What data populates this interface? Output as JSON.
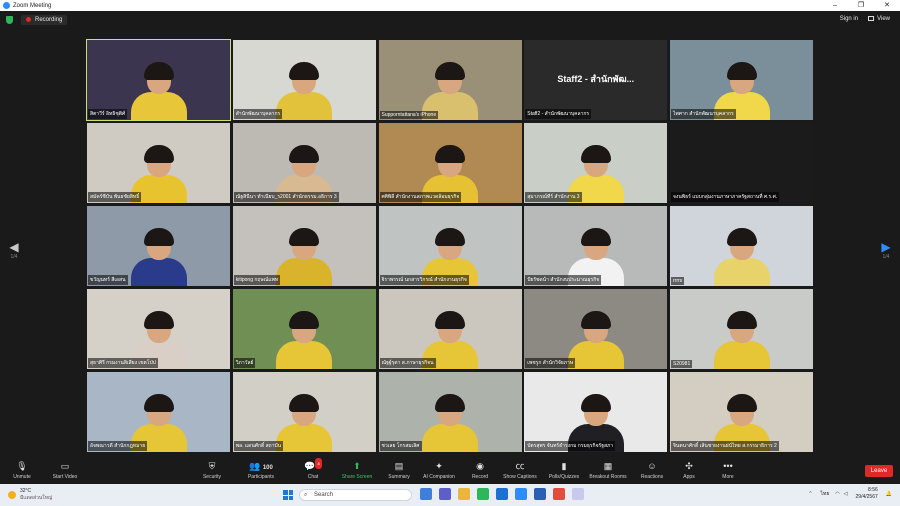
{
  "window": {
    "title": "Zoom Meeting",
    "controls": [
      "–",
      "❐",
      "✕"
    ]
  },
  "topbar": {
    "recording": "Recording",
    "sign_in": "Sign in",
    "view": "View"
  },
  "pager": {
    "left": "1/4",
    "right": "1/4"
  },
  "tiles": [
    {
      "name": "สิตาวีร์ อิทธิชุติศ์",
      "bg": "#3b3550",
      "shirt": "#e8c63a",
      "active": true
    },
    {
      "name": "สำนักพัฒนาบุคลากร",
      "bg": "#d8d8d2",
      "shirt": "#e3c23b"
    },
    {
      "name": "Supporntattana's iPhone",
      "bg": "#9a8f77",
      "shirt": "#d9c06e"
    },
    {
      "name": "Staff2 - สำนักพัฒนาบุคลากร",
      "bg": "#2a2a2a",
      "label": "Staff2 - สำนักพัฒ..."
    },
    {
      "name": "ไพศาก สำนักพัฒนาบุคลากร",
      "bg": "#7b8f9a",
      "shirt": "#f0d84a"
    },
    {
      "name": "สมัคร์ชีบัน พันธชัยสิทธิ์",
      "bg": "#cfcac2",
      "shirt": "#e7c42f"
    },
    {
      "name": "ณัฐสินีนา ทำเนียบ_ร2001 สำนักธรรม.อธิการ 3",
      "bg": "#bdbab3",
      "shirt": "#d8ba92"
    },
    {
      "name": "ศศิพิลี สำนักงานสภาพแวดล้อมธุรกิจ",
      "bg": "#b08a52",
      "shirt": "#e6c133"
    },
    {
      "name": "สุมาภรณ์ทีร์ สำนักงาน 3",
      "bg": "#c9cfc6",
      "shirt": "#f0d84a"
    },
    {
      "name": "จงนพิธร์ แบบกลุ่มงานภาษาภาครัฐสถานที่ ศ.ร.ศ.",
      "bg": "#1b1b1b"
    },
    {
      "name": "ขวัญนทร์ สีเอสน",
      "bg": "#8f9aa8",
      "shirt": "#2a3b8c"
    },
    {
      "name": "kitipong กฤษณ์แพท",
      "bg": "#c4c0bb",
      "shirt": "#d9b32b"
    },
    {
      "name": "จิราพรรณ์ นกสารวิกรณ์ สำนักงานธุรกิจ",
      "bg": "#bfc4c2",
      "shirt": "#e6c537"
    },
    {
      "name": "ปัยรัชดน้า สำนักงบประมาณธุรกิจ",
      "bg": "#b8bab9",
      "shirt": "#f2f2f2"
    },
    {
      "name": "rrrrs",
      "bg": "#cfd5da",
      "shirt": "#e7d36a"
    },
    {
      "name": "สุธาศิรี กรมงานสิเสียง เขตโป่ป",
      "bg": "#d6d1c8",
      "shirt": "#d9cfc6"
    },
    {
      "name": "วิภาวัลย์",
      "bg": "#6f8f55",
      "shirt": "#e6c537"
    },
    {
      "name": "ณัฐฐ์รุดา ส.ภาษาธุรกิจน",
      "bg": "#cbc7be",
      "shirt": "#e6c537"
    },
    {
      "name": "เพชรูก สำนักวิจัยภาษ",
      "bg": "#8d8a84",
      "shirt": "#e6c537"
    },
    {
      "name": "S20981",
      "bg": "#c9cbc8",
      "shirt": "#e6c537"
    },
    {
      "name": "อัจพณาวดี สำนักกฎหมาย",
      "bg": "#a9b6c6",
      "shirt": "#e6c537"
    },
    {
      "name": "พล. แดนศักดิ์ สถาบัน",
      "bg": "#d2cfc7",
      "shirt": "#e6c537"
    },
    {
      "name": "ชวเลย โกรสมเลิศ",
      "bg": "#adb3aa",
      "shirt": "#e6c537"
    },
    {
      "name": "บัตรสุพร จันทร์ธำรงกม กรมธุรกิจรัฐสภา",
      "bg": "#e9e9e9",
      "shirt": "#1f1f24"
    },
    {
      "name": "จินตนาศักดิ์ เส้นชายงานฝน์ไทย ส.กรรมาธิการ 2",
      "bg": "#d4cdc1",
      "shirt": "#e6c537"
    }
  ],
  "toolbar": {
    "unmute": "Unmute",
    "start_video": "Start Video",
    "security": "Security",
    "participants": "Participants",
    "participants_count": "100",
    "chat": "Chat",
    "chat_badge": "8",
    "share_screen": "Share Screen",
    "summary": "Summary",
    "ai_companion": "AI Companion",
    "record": "Record",
    "show_captions": "Show Captions",
    "polls": "Polls/Quizzes",
    "breakout": "Breakout Rooms",
    "reactions": "Reactions",
    "apps": "Apps",
    "more": "More",
    "leave": "Leave"
  },
  "taskbar": {
    "temperature": "32°C",
    "weather_desc": "มีแดดส่วนใหญ่",
    "search_placeholder": "Search",
    "language": "ไทย",
    "time": "8:56",
    "date": "29/4/2567"
  },
  "colors": {
    "accent": "#2d8cff",
    "leave": "#e02828",
    "active_border": "#c9e36a",
    "share_green": "#2fb55a"
  }
}
